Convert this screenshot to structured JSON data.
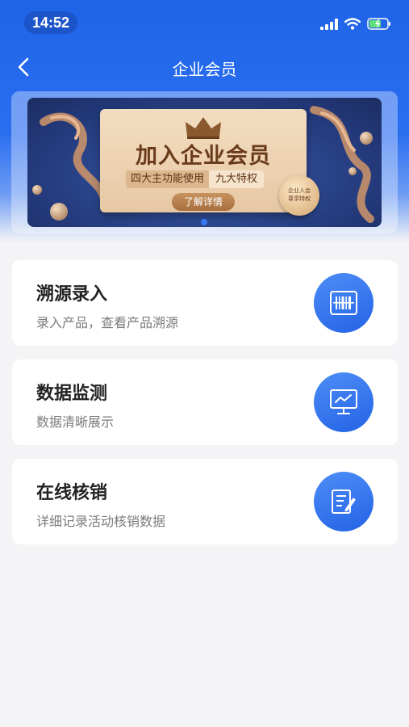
{
  "status_bar": {
    "time": "14:52",
    "icons": [
      "signal-icon",
      "wifi-icon",
      "battery-charging-icon"
    ]
  },
  "nav": {
    "title": "企业会员",
    "back_icon": "chevron-left-icon"
  },
  "banner": {
    "title": "加入企业会员",
    "subtitle_left": "四大主功能使用",
    "subtitle_right": "九大特权",
    "button_label": "了解详情",
    "seal_line1": "企业入会",
    "seal_line2": "尊享特权"
  },
  "features": [
    {
      "title": "溯源录入",
      "desc": "录入产品，查看产品溯源",
      "icon": "barcode-scan-icon"
    },
    {
      "title": "数据监测",
      "desc": "数据清晰展示",
      "icon": "monitor-chart-icon"
    },
    {
      "title": "在线核销",
      "desc": "详细记录活动核销数据",
      "icon": "document-edit-icon"
    }
  ],
  "colors": {
    "primary": "#2463e6",
    "background": "#f4f4f6",
    "gold": "#a86d3c"
  }
}
